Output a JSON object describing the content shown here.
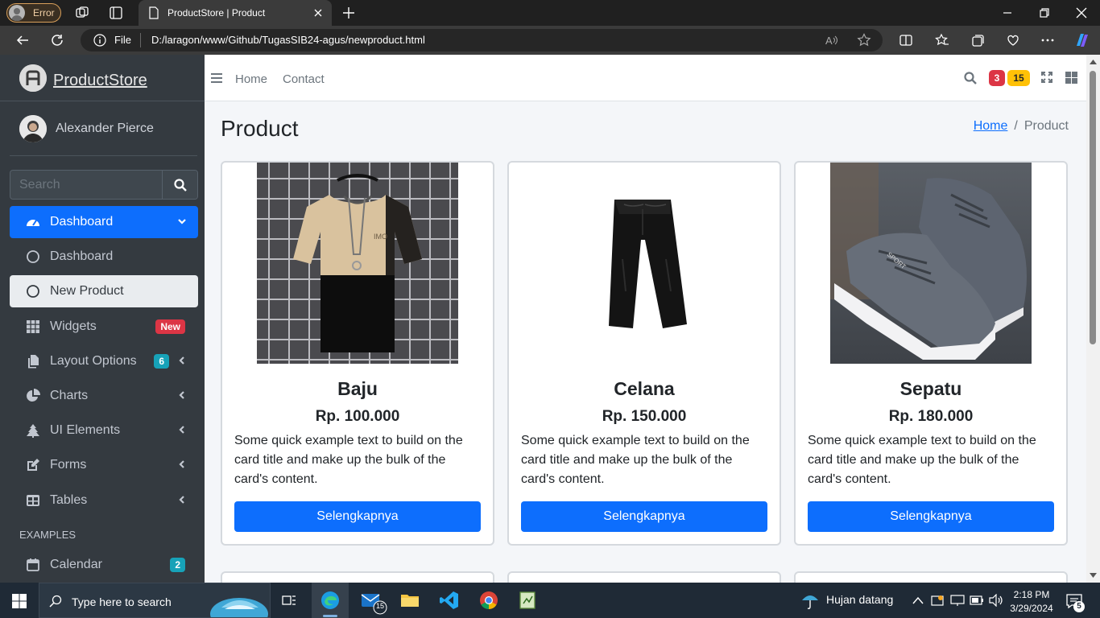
{
  "browser": {
    "profile_label": "Error",
    "tab_title": "ProductStore | Product",
    "scheme_label": "File",
    "url": "D:/laragon/www/Github/TugasSIB24-agus/newproduct.html",
    "profile_color": "#d9a05b"
  },
  "sidebar": {
    "brand": "ProductStore",
    "user_name": "Alexander Pierce",
    "search_placeholder": "Search",
    "items": [
      {
        "label": "Dashboard",
        "icon": "tachometer-icon",
        "state": "active"
      },
      {
        "label": "Dashboard",
        "icon": "circle-icon",
        "state": "normal"
      },
      {
        "label": "New Product",
        "icon": "circle-icon",
        "state": "selected"
      },
      {
        "label": "Widgets",
        "icon": "grid-icon",
        "badge": "New",
        "badge_color": "#dc3545"
      },
      {
        "label": "Layout Options",
        "icon": "copy-icon",
        "badge": "6",
        "badge_color": "#17a2b8"
      },
      {
        "label": "Charts",
        "icon": "pie-chart-icon"
      },
      {
        "label": "UI Elements",
        "icon": "tree-icon"
      },
      {
        "label": "Forms",
        "icon": "edit-icon"
      },
      {
        "label": "Tables",
        "icon": "table-icon"
      },
      {
        "label": "Calendar",
        "icon": "calendar-icon",
        "badge": "2",
        "badge_color": "#17a2b8"
      }
    ],
    "section_header": "EXAMPLES",
    "accent_color": "#0d6efd"
  },
  "topnav": {
    "links": [
      "Home",
      "Contact"
    ],
    "messages_count": "3",
    "notifications_count": "15"
  },
  "page": {
    "title": "Product",
    "breadcrumb_home": "Home",
    "breadcrumb_current": "Product"
  },
  "products": [
    {
      "name": "Baju",
      "price": "Rp. 100.000",
      "description": "Some quick example text to build on the card title and make up the bulk of the card's content.",
      "button": "Selengkapnya"
    },
    {
      "name": "Celana",
      "price": "Rp. 150.000",
      "description": "Some quick example text to build on the card title and make up the bulk of the card's content.",
      "button": "Selengkapnya"
    },
    {
      "name": "Sepatu",
      "price": "Rp. 180.000",
      "description": "Some quick example text to build on the card title and make up the bulk of the card's content.",
      "button": "Selengkapnya"
    }
  ],
  "taskbar": {
    "search_placeholder": "Type here to search",
    "mail_badge": "15",
    "weather": "Hujan datang",
    "time": "2:18 PM",
    "date": "3/29/2024",
    "notification_count": "5"
  }
}
